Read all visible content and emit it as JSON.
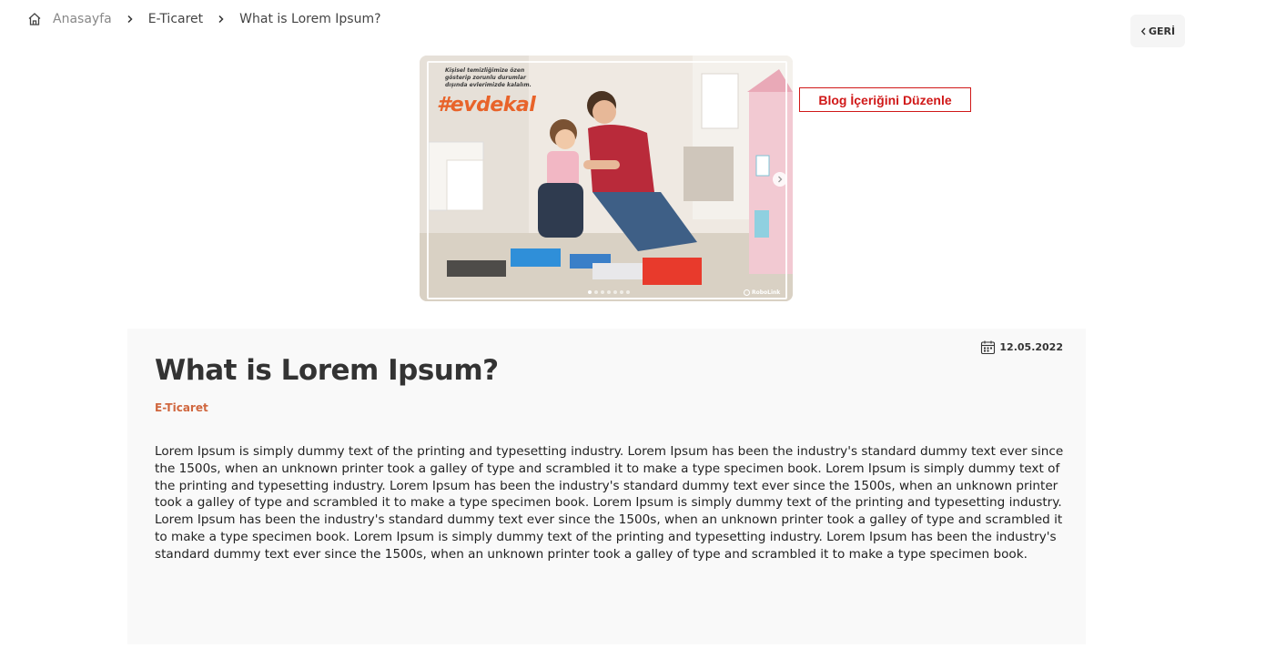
{
  "breadcrumb": {
    "home": "Anasayfa",
    "category": "E-Ticaret",
    "current": "What is Lorem Ipsum?"
  },
  "back_button": {
    "label": "GERİ"
  },
  "hero": {
    "caption": "Kişisel temizliğimize özen gösterip zorunlu durumlar dışında evlerimizde kalalım.",
    "hashtag": "#evdekal",
    "logo_text": "RoboLink",
    "slide_count": 7,
    "active_slide": 1
  },
  "edit_button": {
    "label": "Blog İçeriğini Düzenle",
    "color": "#d01818"
  },
  "article": {
    "date": "12.05.2022",
    "title": "What is Lorem Ipsum?",
    "category": "E-Ticaret",
    "category_color": "#d0673f",
    "body": "Lorem Ipsum is simply dummy text of the printing and typesetting industry. Lorem Ipsum has been the industry's standard dummy text ever since the 1500s, when an unknown printer took a galley of type and scrambled it to make a type specimen book. Lorem Ipsum is simply dummy text of the printing and typesetting industry. Lorem Ipsum has been the industry's standard dummy text ever since the 1500s, when an unknown printer took a galley of type and scrambled it to make a type specimen book. Lorem Ipsum is simply dummy text of the printing and typesetting industry. Lorem Ipsum has been the industry's standard dummy text ever since the 1500s, when an unknown printer took a galley of type and scrambled it to make a type specimen book. Lorem Ipsum is simply dummy text of the printing and typesetting industry. Lorem Ipsum has been the industry's standard dummy text ever since the 1500s, when an unknown printer took a galley of type and scrambled it to make a type specimen book."
  },
  "icons": {
    "home": "home-icon",
    "separator": "chevron-right-icon",
    "back": "chevron-left-icon",
    "calendar": "calendar-icon",
    "next_slide": "chevron-right-icon"
  }
}
